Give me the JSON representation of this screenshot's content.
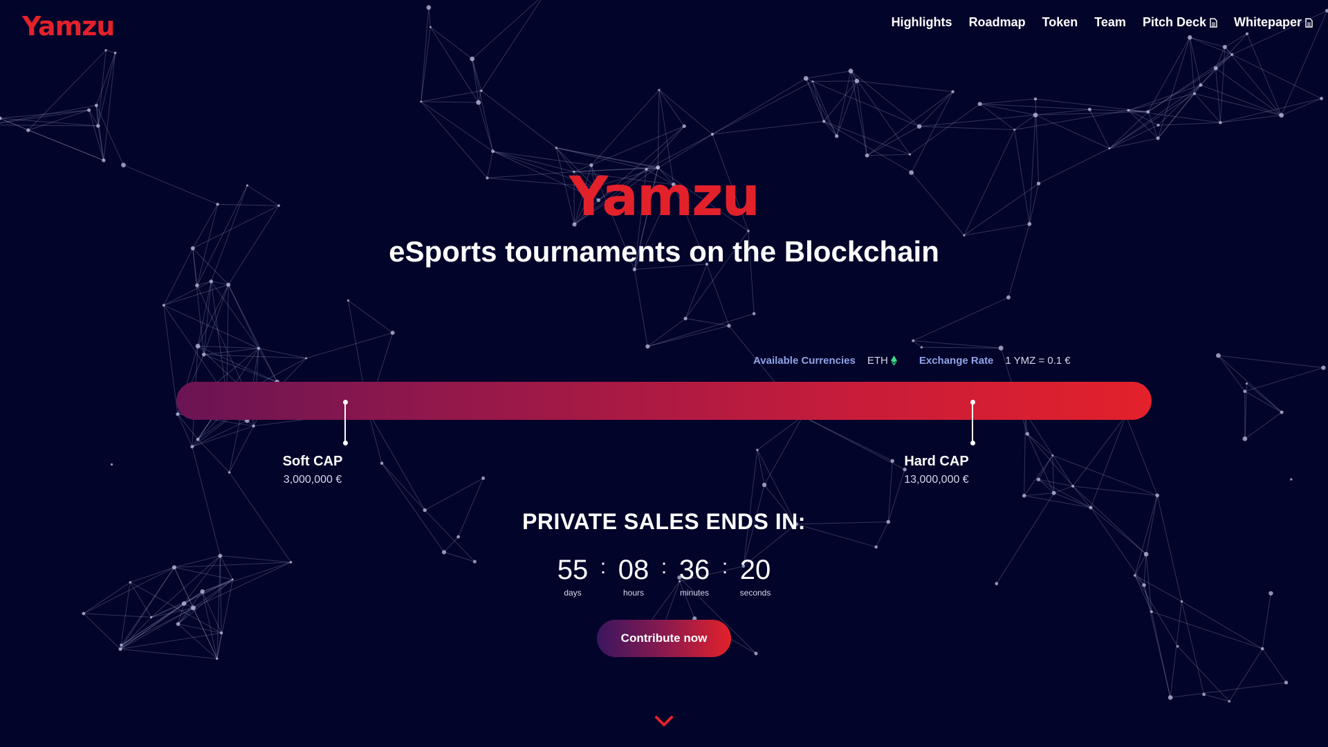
{
  "header": {
    "logo": "Yamzu",
    "nav": [
      {
        "label": "Highlights",
        "icon": null
      },
      {
        "label": "Roadmap",
        "icon": null
      },
      {
        "label": "Token",
        "icon": null
      },
      {
        "label": "Team",
        "icon": null
      },
      {
        "label": "Pitch Deck",
        "icon": "document-icon"
      },
      {
        "label": "Whitepaper",
        "icon": "document-icon"
      }
    ]
  },
  "hero": {
    "logo": "Yamzu",
    "tagline": "eSports tournaments on the Blockchain"
  },
  "sale_info": {
    "currencies_label": "Available Currencies",
    "currencies_value": "ETH",
    "currency_icon": "ethereum-icon",
    "exchange_label": "Exchange Rate",
    "exchange_value": "1 YMZ = 0.1 €"
  },
  "caps": {
    "soft": {
      "title": "Soft CAP",
      "amount": "3,000,000 €"
    },
    "hard": {
      "title": "Hard CAP",
      "amount": "13,000,000 €"
    }
  },
  "countdown": {
    "title": "PRIVATE SALES ENDS IN:",
    "units": [
      {
        "value": "55",
        "label": "days"
      },
      {
        "value": "08",
        "label": "hours"
      },
      {
        "value": "36",
        "label": "minutes"
      },
      {
        "value": "20",
        "label": "seconds"
      }
    ],
    "separator": ":"
  },
  "cta": {
    "label": "Contribute now"
  },
  "colors": {
    "background": "#03042a",
    "brand_red": "#e3212b",
    "bar_start": "#6a1454",
    "bar_end": "#e3212b",
    "label_blue": "#8fa3e6",
    "eth_green": "#3ddc84"
  },
  "scroll_icon": "chevron-down-icon"
}
